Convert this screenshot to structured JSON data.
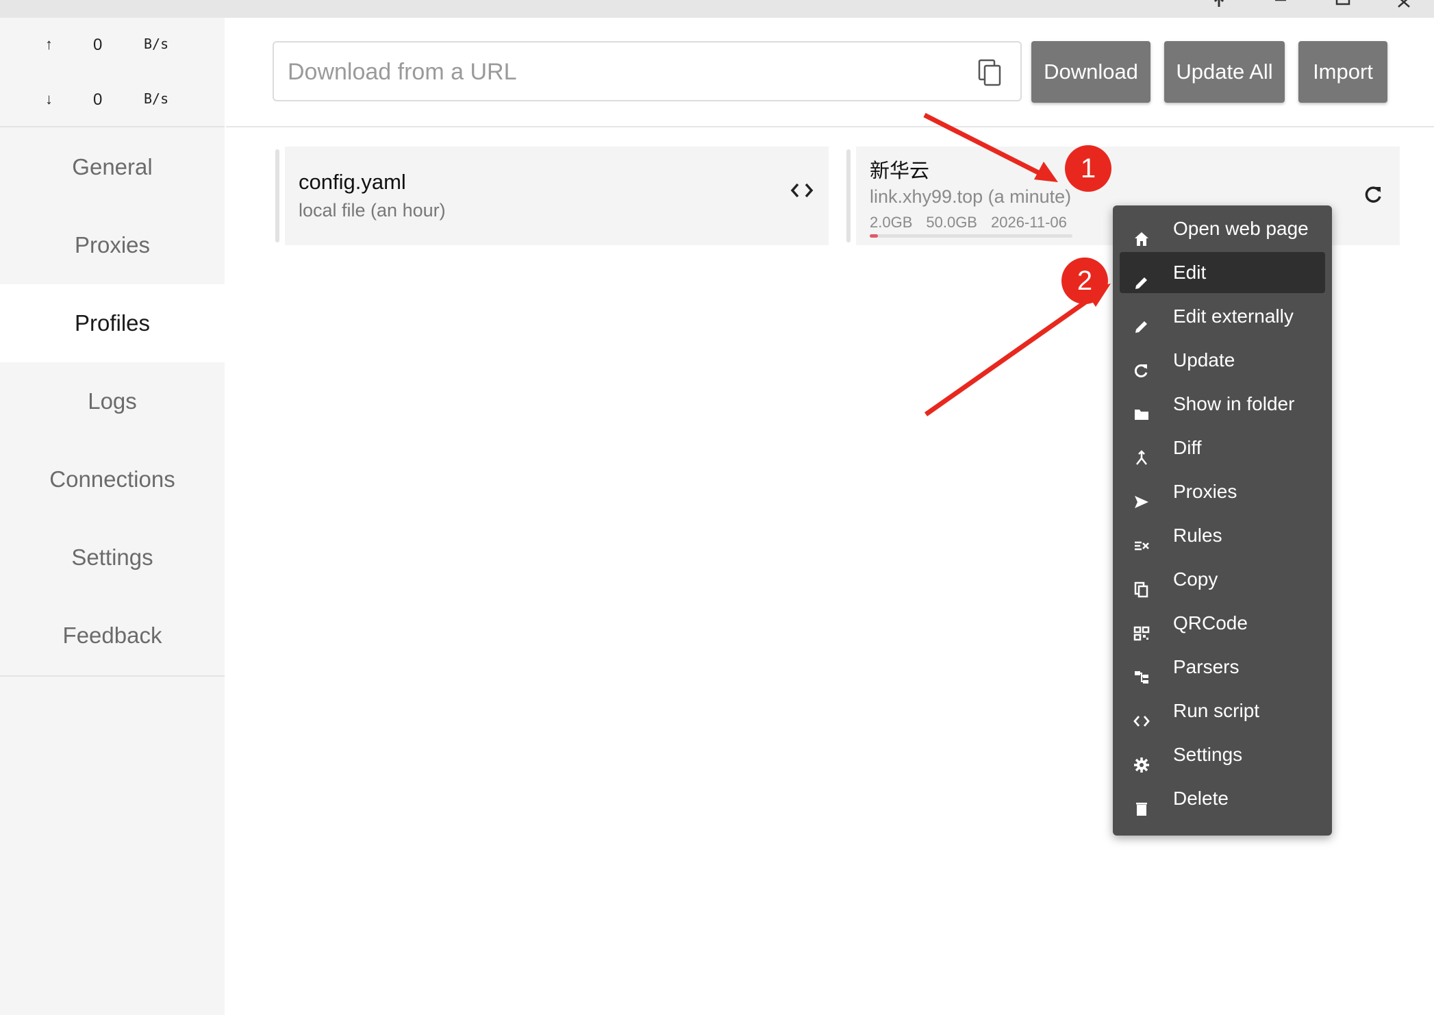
{
  "window": {
    "controls": [
      "pin-icon",
      "minimize-icon",
      "maximize-icon",
      "close-icon"
    ]
  },
  "traffic": {
    "up": {
      "arrow": "↑",
      "value": "0",
      "unit": "B/s"
    },
    "down": {
      "arrow": "↓",
      "value": "0",
      "unit": "B/s"
    }
  },
  "sidebar": {
    "items": [
      {
        "label": "General"
      },
      {
        "label": "Proxies"
      },
      {
        "label": "Profiles",
        "active": true
      },
      {
        "label": "Logs"
      },
      {
        "label": "Connections"
      },
      {
        "label": "Settings"
      },
      {
        "label": "Feedback"
      }
    ]
  },
  "header": {
    "url_placeholder": "Download from a URL",
    "url_value": "",
    "download_label": "Download",
    "update_all_label": "Update All",
    "import_label": "Import"
  },
  "profiles": [
    {
      "title": "config.yaml",
      "subtitle": "local file (an hour)",
      "action_icon": "code-icon"
    },
    {
      "title": "新华云",
      "subtitle": "link.xhy99.top (a minute)",
      "used": "2.0GB",
      "total": "50.0GB",
      "expire": "2026-11-06",
      "usage_fraction": 0.04,
      "action_icon": "refresh-icon"
    }
  ],
  "context_menu": {
    "items": [
      {
        "label": "Open web page",
        "icon": "home-icon"
      },
      {
        "label": "Edit",
        "icon": "pencil-icon",
        "active": true
      },
      {
        "label": "Edit externally",
        "icon": "pencil-icon"
      },
      {
        "label": "Update",
        "icon": "refresh-icon"
      },
      {
        "label": "Show in folder",
        "icon": "folder-icon"
      },
      {
        "label": "Diff",
        "icon": "diff-icon"
      },
      {
        "label": "Proxies",
        "icon": "send-icon"
      },
      {
        "label": "Rules",
        "icon": "rules-icon"
      },
      {
        "label": "Copy",
        "icon": "copy-icon"
      },
      {
        "label": "QRCode",
        "icon": "qrcode-icon"
      },
      {
        "label": "Parsers",
        "icon": "parser-icon"
      },
      {
        "label": "Run script",
        "icon": "code-icon"
      },
      {
        "label": "Settings",
        "icon": "gear-icon"
      },
      {
        "label": "Delete",
        "icon": "trash-icon"
      }
    ]
  },
  "annotations": {
    "badge1": "1",
    "badge2": "2",
    "color": "#e8281e"
  }
}
